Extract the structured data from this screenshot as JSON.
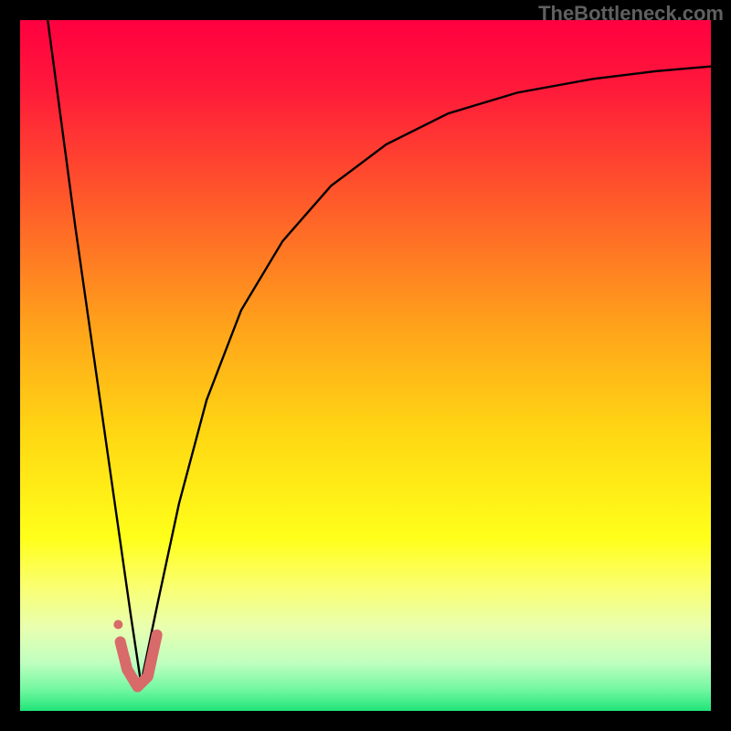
{
  "watermark": "TheBottleneck.com",
  "chart_data": {
    "type": "line",
    "title": "",
    "xlabel": "",
    "ylabel": "",
    "xlim": [
      0,
      100
    ],
    "ylim": [
      0,
      100
    ],
    "background_gradient": {
      "stops": [
        {
          "offset": 0.0,
          "color": "#ff0040"
        },
        {
          "offset": 0.1,
          "color": "#ff1a3a"
        },
        {
          "offset": 0.25,
          "color": "#ff552b"
        },
        {
          "offset": 0.45,
          "color": "#ffa51a"
        },
        {
          "offset": 0.6,
          "color": "#ffd813"
        },
        {
          "offset": 0.75,
          "color": "#ffff1a"
        },
        {
          "offset": 0.82,
          "color": "#faff70"
        },
        {
          "offset": 0.88,
          "color": "#e8ffb0"
        },
        {
          "offset": 0.93,
          "color": "#c0ffc0"
        },
        {
          "offset": 0.97,
          "color": "#70f7a0"
        },
        {
          "offset": 1.0,
          "color": "#20e478"
        }
      ]
    },
    "series": [
      {
        "name": "left-branch",
        "stroke": "#000000",
        "stroke_width": 2.4,
        "x": [
          4,
          6,
          8,
          10,
          12,
          14,
          16,
          17.5
        ],
        "y": [
          100,
          85,
          70,
          56,
          42,
          28,
          14,
          4
        ]
      },
      {
        "name": "right-branch",
        "stroke": "#000000",
        "stroke_width": 2.4,
        "x": [
          17.5,
          20,
          23,
          27,
          32,
          38,
          45,
          53,
          62,
          72,
          83,
          92,
          100
        ],
        "y": [
          4,
          16,
          30,
          45,
          58,
          68,
          76,
          82,
          86.5,
          89.5,
          91.5,
          92.6,
          93.3
        ]
      },
      {
        "name": "valley-marker",
        "stroke": "#d86a6a",
        "stroke_width": 12,
        "linecap": "round",
        "x": [
          14.5,
          15.5,
          17.0,
          18.5,
          19.8
        ],
        "y": [
          10,
          6,
          3.5,
          5,
          11
        ]
      }
    ],
    "points": [
      {
        "name": "dot-left-upper",
        "x": 14.2,
        "y": 12.5,
        "r": 5,
        "fill": "#d86a6a"
      },
      {
        "name": "dot-left-lower",
        "x": 15.3,
        "y": 7.5,
        "r": 5,
        "fill": "#d86a6a"
      }
    ]
  }
}
